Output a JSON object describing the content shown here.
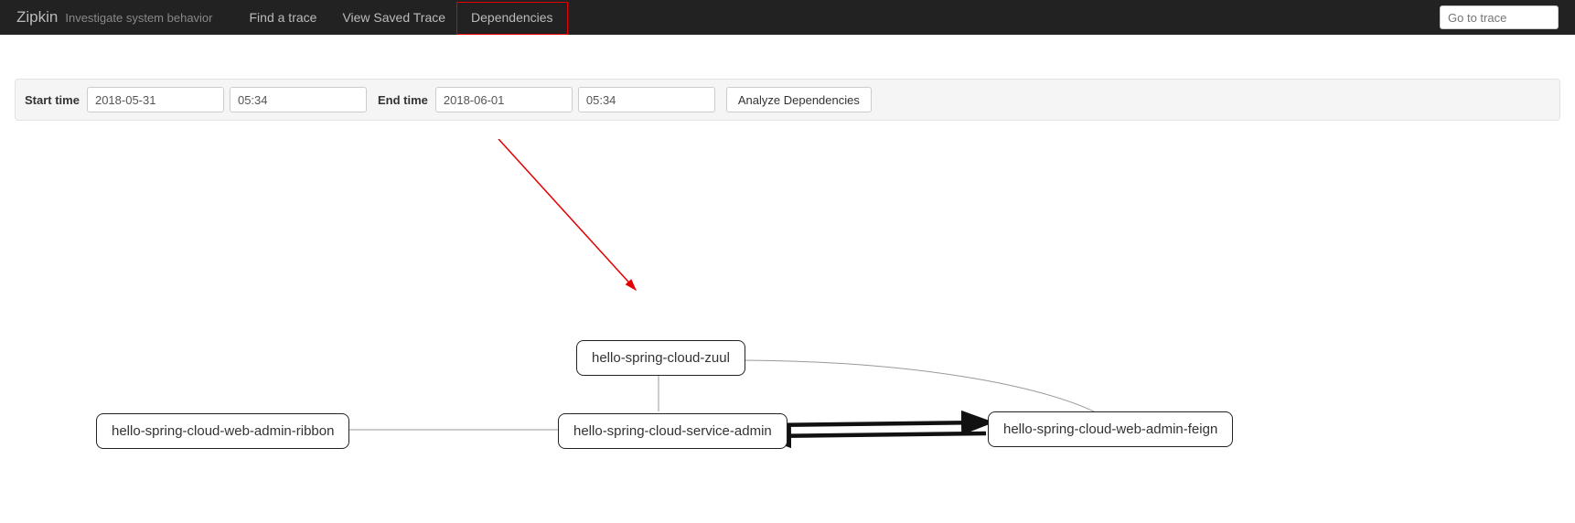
{
  "header": {
    "brand": "Zipkin",
    "tagline": "Investigate system behavior",
    "nav": {
      "find": "Find a trace",
      "viewSaved": "View Saved Trace",
      "dependencies": "Dependencies"
    },
    "gotoPlaceholder": "Go to trace"
  },
  "filter": {
    "startLabel": "Start time",
    "startDate": "2018-05-31",
    "startTime": "05:34",
    "endLabel": "End time",
    "endDate": "2018-06-01",
    "endTime": "05:34",
    "analyzeBtn": "Analyze Dependencies"
  },
  "graph": {
    "nodes": {
      "zuul": "hello-spring-cloud-zuul",
      "ribbon": "hello-spring-cloud-web-admin-ribbon",
      "service": "hello-spring-cloud-service-admin",
      "feign": "hello-spring-cloud-web-admin-feign"
    }
  }
}
